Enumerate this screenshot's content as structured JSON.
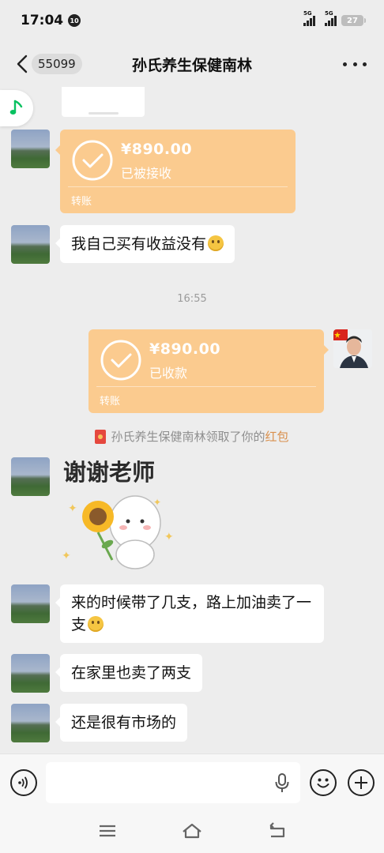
{
  "status_bar": {
    "time": "17:04",
    "notification_badge": "10",
    "signal_1_label": "5G",
    "signal_2_label": "5G",
    "battery": "27"
  },
  "header": {
    "unread_count": "55099",
    "title": "孙氏养生保健南林"
  },
  "messages": {
    "transfer_received": {
      "amount": "¥890.00",
      "status": "已被接收",
      "kind": "转账"
    },
    "text_1": "我自己买有收益没有",
    "timestamp": "16:55",
    "transfer_sent": {
      "amount": "¥890.00",
      "status": "已收款",
      "kind": "转账"
    },
    "system_message": {
      "prefix": "孙氏养生保健南林领取了你的",
      "link": "红包"
    },
    "sticker_text": "谢谢老师",
    "text_2": "来的时候带了几支，路上加油卖了一支",
    "text_3": "在家里也卖了两支",
    "text_4": "还是很有市场的"
  },
  "colors": {
    "background": "#ededed",
    "transfer": "#fbcb8f",
    "link": "#d9904d",
    "music_green": "#07c160"
  },
  "icons": {
    "back": "chevron-left-icon",
    "more": "more-dots-icon",
    "music": "music-note-icon",
    "voice": "voice-icon",
    "mic": "mic-icon",
    "emoji": "emoji-icon",
    "plus": "plus-icon"
  }
}
